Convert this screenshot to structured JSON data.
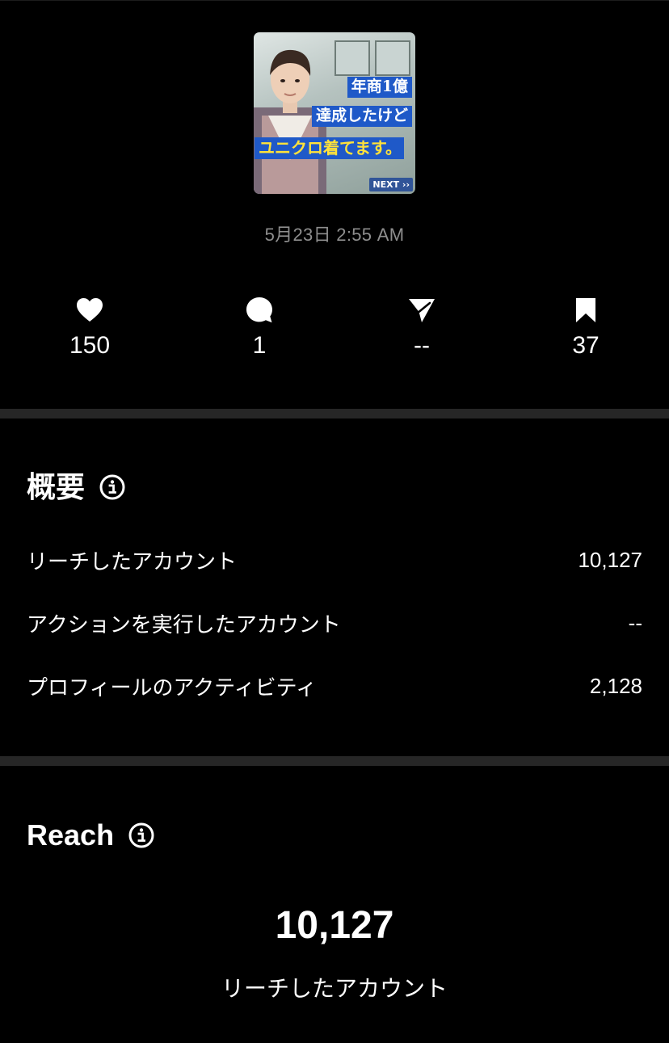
{
  "post": {
    "thumbnail": {
      "caption_line1": "年商1億",
      "caption_line2": "達成したけど",
      "caption_line3": "ユニクロ着てます。",
      "next_label": "NEXT ››"
    },
    "date": "5月23日 2:55 AM"
  },
  "stats": {
    "likes": "150",
    "comments": "1",
    "shares": "--",
    "saves": "37",
    "icons": [
      "heart-icon",
      "comment-icon",
      "send-icon",
      "bookmark-icon"
    ]
  },
  "overview": {
    "title": "概要",
    "rows": [
      {
        "label": "リーチしたアカウント",
        "value": "10,127"
      },
      {
        "label": "アクションを実行したアカウント",
        "value": "--"
      },
      {
        "label": "プロフィールのアクティビティ",
        "value": "2,128"
      }
    ]
  },
  "reach": {
    "title": "Reach",
    "value": "10,127",
    "label": "リーチしたアカウント"
  },
  "colors": {
    "background": "#000000",
    "divider": "#262626",
    "muted_text": "#8e8e8e",
    "caption_blue": "#1f59c8",
    "caption_yellow": "#ffe23a"
  }
}
